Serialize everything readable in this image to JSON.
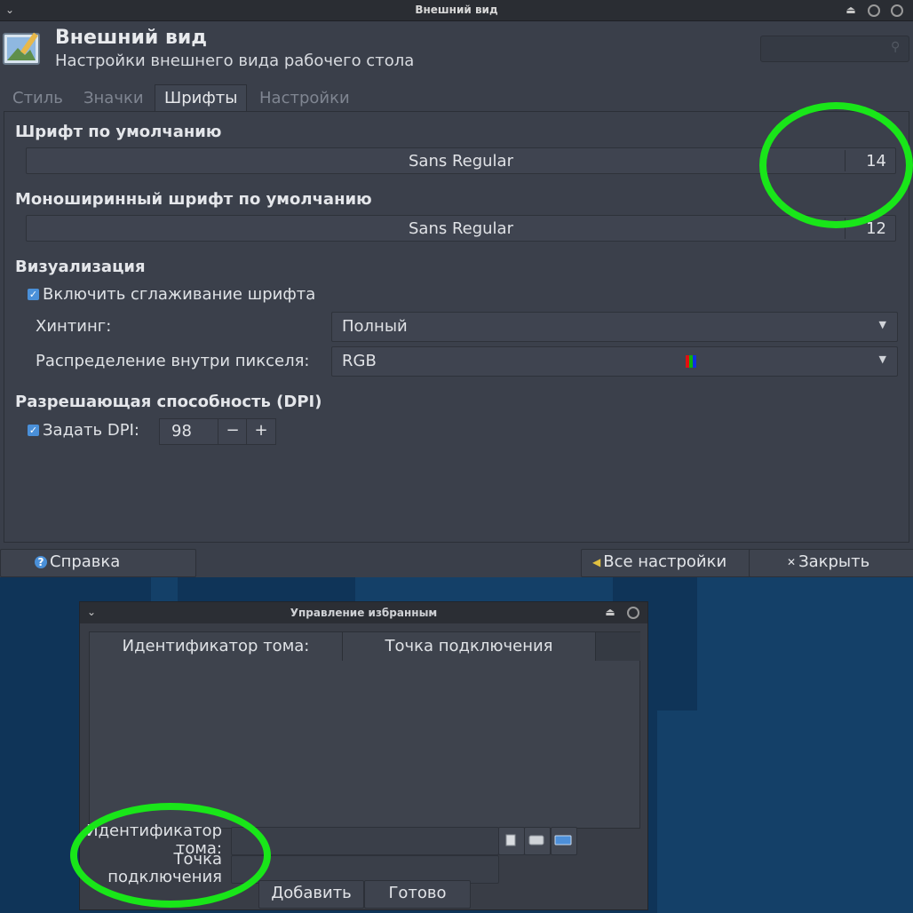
{
  "window": {
    "title": "Внешний вид",
    "header_title": "Внешний вид",
    "header_subtitle": "Настройки внешнего вида рабочего стола",
    "tabs": [
      {
        "label": "Стиль",
        "active": false
      },
      {
        "label": "Значки",
        "active": false
      },
      {
        "label": "Шрифты",
        "active": true
      },
      {
        "label": "Настройки",
        "active": false
      }
    ],
    "default_font": {
      "heading": "Шрифт по умолчанию",
      "name": "Sans Regular",
      "size": "14"
    },
    "mono_font": {
      "heading": "Моноширинный шрифт по умолчанию",
      "name": "Sans Regular",
      "size": "12"
    },
    "rendering": {
      "heading": "Визуализация",
      "antialias_label": "Включить сглаживание шрифта",
      "antialias_checked": true,
      "hinting_label": "Хинтинг:",
      "hinting_value": "Полный",
      "subpixel_label": "Распределение внутри пикселя:",
      "subpixel_value": "RGB",
      "subpixel_colors": [
        "#e01010",
        "#10b010",
        "#1030e0"
      ]
    },
    "dpi": {
      "heading": "Разрешающая способность (DPI)",
      "custom_label": "Задать DPI:",
      "custom_checked": true,
      "value": "98",
      "minus": "−",
      "plus": "+"
    },
    "buttons": {
      "help": "Справка",
      "all_settings": "Все настройки",
      "close": "Закрыть"
    }
  },
  "favorites_dialog": {
    "title": "Управление избранным",
    "columns": [
      "Идентификатор тома:",
      "Точка подключения"
    ],
    "volume_id_label": "Идентификатор тома:",
    "mount_point_label": "Точка подключения",
    "volume_id_value": "",
    "mount_point_value": "",
    "add_button": "Добавить",
    "done_button": "Готово"
  },
  "annotation_color": "#19e619"
}
